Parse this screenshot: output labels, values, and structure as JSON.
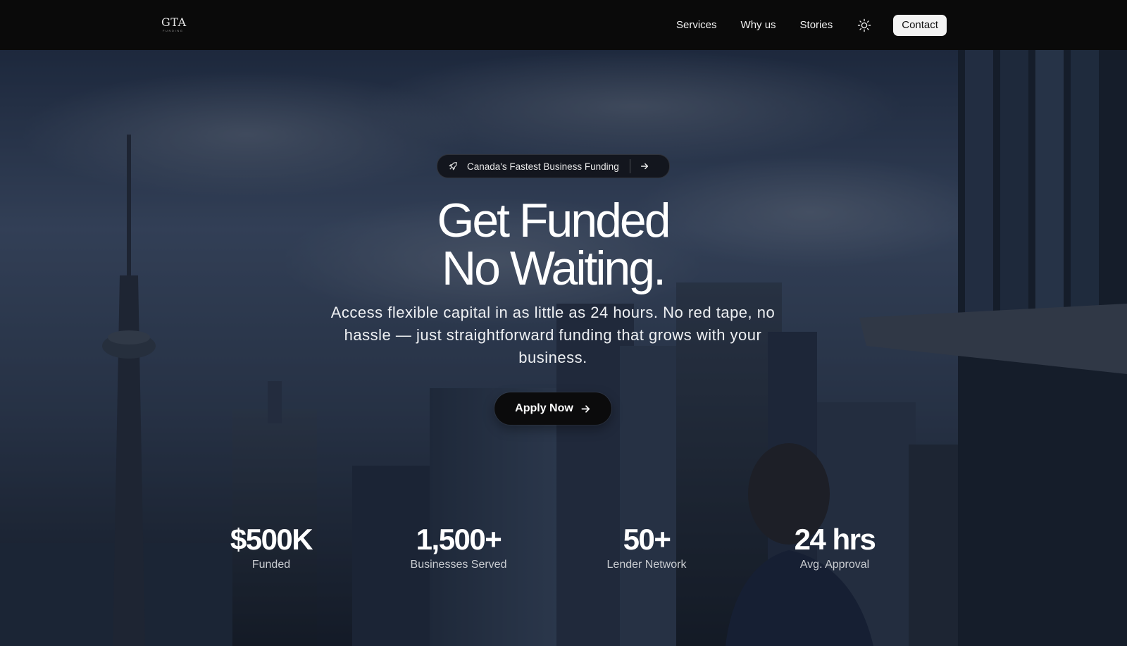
{
  "brand": {
    "logo_text": "GTA",
    "logo_sub": "FUNDING"
  },
  "nav": {
    "links": [
      "Services",
      "Why us",
      "Stories"
    ],
    "theme_icon": "sun-icon",
    "contact_label": "Contact"
  },
  "hero": {
    "badge_icon": "rocket-icon",
    "badge_text": "Canada's Fastest Business Funding",
    "badge_arrow_icon": "arrow-right-icon",
    "headline_line1": "Get Funded",
    "headline_line2": "No Waiting.",
    "subtext": "Access flexible capital in as little as 24 hours. No red tape, no hassle — just straightforward funding that grows with your business.",
    "cta_label": "Apply Now",
    "cta_icon": "arrow-right-icon"
  },
  "stats": [
    {
      "value": "$500K",
      "label": "Funded"
    },
    {
      "value": "1,500+",
      "label": "Businesses Served"
    },
    {
      "value": "50+",
      "label": "Lender Network"
    },
    {
      "value": "24 hrs",
      "label": "Avg. Approval"
    }
  ]
}
